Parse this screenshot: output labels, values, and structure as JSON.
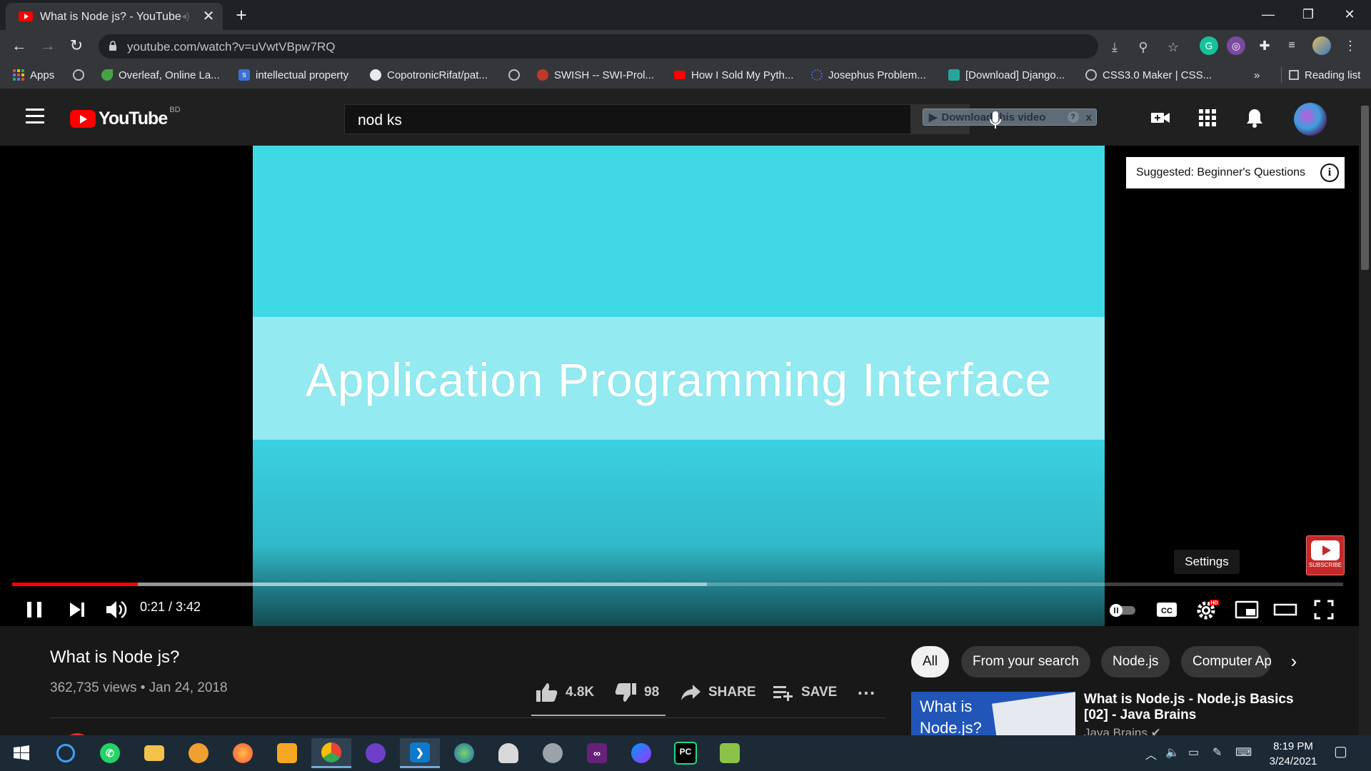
{
  "browser": {
    "tab_title": "What is Node js? - YouTube",
    "url": "youtube.com/watch?v=uVwtVBpw7RQ",
    "bookmarks": [
      {
        "label": "Apps",
        "color": "#e8453c"
      },
      {
        "label": "",
        "color": "#9aa0a6"
      },
      {
        "label": "Overleaf, Online La...",
        "color": "#46a247"
      },
      {
        "label": "intellectual property",
        "color": "#3b6fd6"
      },
      {
        "label": "CopotronicRifat/pat...",
        "color": "#e8eaed"
      },
      {
        "label": "",
        "color": "#9aa0a6"
      },
      {
        "label": "SWISH -- SWI-Prol...",
        "color": "#c0392b"
      },
      {
        "label": "How I Sold My Pyth...",
        "color": "#ff0000"
      },
      {
        "label": "Josephus Problem...",
        "color": "#4a6ad8"
      },
      {
        "label": "[Download] Django...",
        "color": "#26a69a"
      },
      {
        "label": "CSS3.0 Maker | CSS...",
        "color": "#9aa0a6"
      }
    ],
    "more_bookmarks": "»",
    "reading_list": "Reading list"
  },
  "youtube": {
    "logo_word": "YouTube",
    "country_code": "BD",
    "search_value": "nod ks",
    "download_overlay": "Download this video",
    "download_overlay_help": "?",
    "download_overlay_close": "x"
  },
  "player": {
    "slide_text": "Application Programming Interface",
    "suggested": "Suggested: Beginner's Questions",
    "settings_tooltip": "Settings",
    "subscribe_watermark": "SUBSCRIBE",
    "time": "0:21 / 3:42",
    "progress_fraction": 0.0946,
    "buffered_fraction": 0.522
  },
  "video": {
    "title": "What is Node js?",
    "meta": "362,735 views • Jan 24, 2018",
    "likes": "4.8K",
    "dislikes": "98",
    "share": "SHARE",
    "save": "SAVE"
  },
  "chips": [
    "All",
    "From your search",
    "Node.js",
    "Computer Ap"
  ],
  "recommendation": {
    "thumb_text": "What is Node.js?",
    "title": "What is Node.js - Node.js Basics [02] - Java Brains",
    "channel": "Java Brains"
  },
  "taskbar": {
    "time": "8:19 PM",
    "date": "3/24/2021"
  }
}
